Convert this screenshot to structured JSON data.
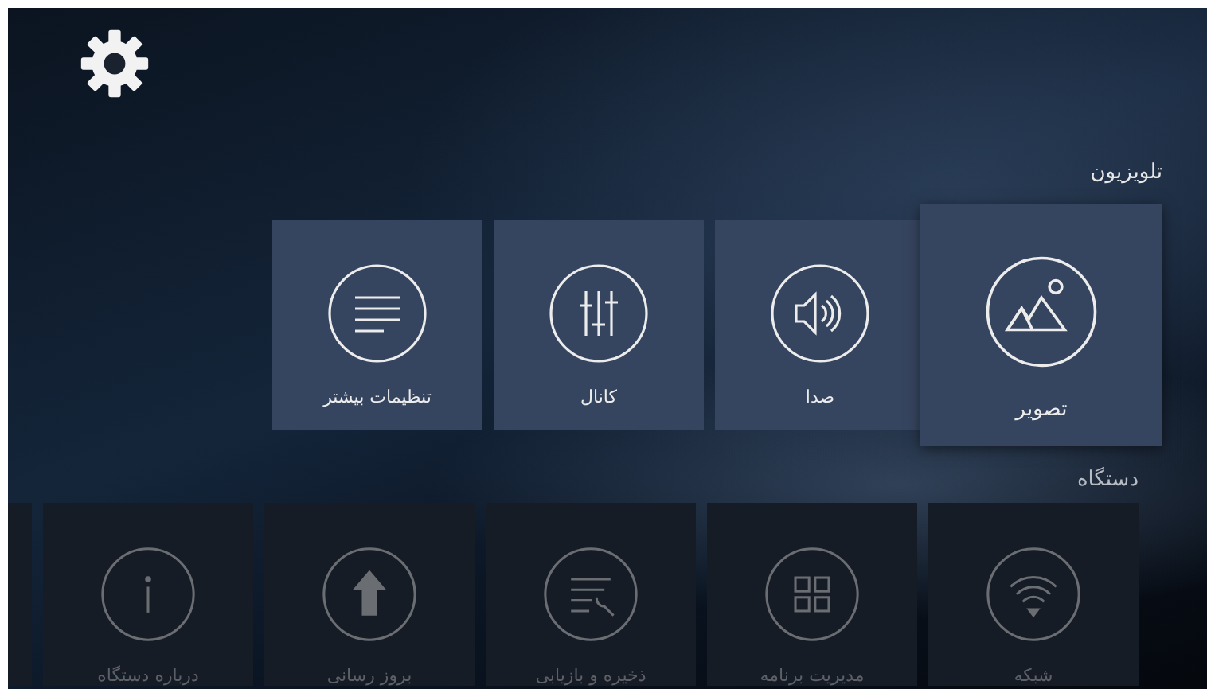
{
  "settings_icon": {
    "kind": "gear"
  },
  "sections": [
    {
      "title": "تلویزیون",
      "active": true,
      "tiles": [
        {
          "label": "تصویر",
          "kind": "picture",
          "selected": true
        },
        {
          "label": "صدا",
          "kind": "speaker",
          "selected": false
        },
        {
          "label": "کانال",
          "kind": "sliders",
          "selected": false
        },
        {
          "label": "تنظیمات بیشتر",
          "kind": "lines",
          "selected": false
        }
      ]
    },
    {
      "title": "دستگاه",
      "active": false,
      "tiles": [
        {
          "label": "شبکه",
          "kind": "wifi",
          "selected": false
        },
        {
          "label": "مدیریت برنامه",
          "kind": "grid",
          "selected": false
        },
        {
          "label": "ذخیره و بازیابی",
          "kind": "wrench",
          "selected": false
        },
        {
          "label": "بروز رسانی",
          "kind": "upload",
          "selected": false
        },
        {
          "label": "درباره دستگاه",
          "kind": "info",
          "selected": false
        }
      ]
    }
  ]
}
